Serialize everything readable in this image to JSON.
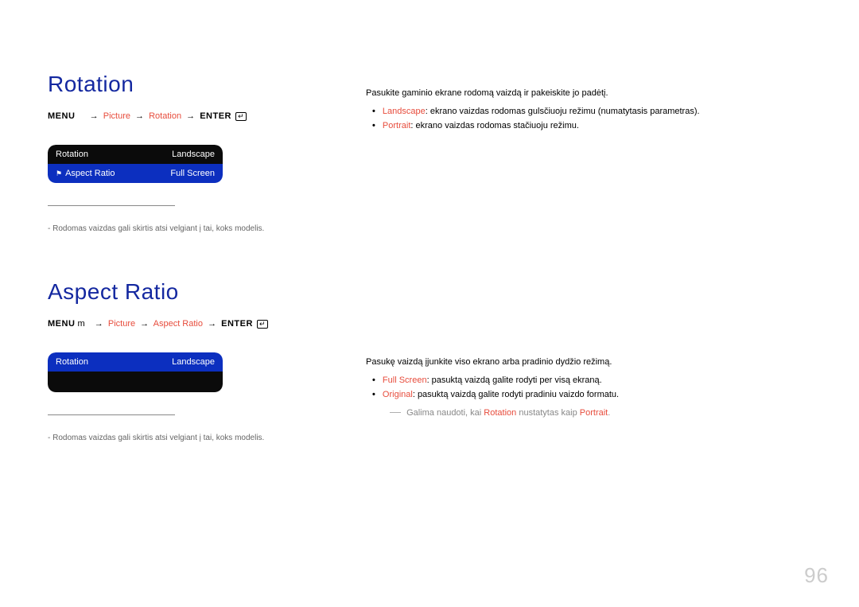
{
  "page_number": "96",
  "rotation": {
    "heading": "Rotation",
    "breadcrumb": {
      "menu": "MENU",
      "arrow": "→",
      "picture": "Picture",
      "rotation": "Rotation",
      "enter": "ENTER"
    },
    "ui": {
      "row1_label": "Rotation",
      "row1_value": "Landscape",
      "row2_label": "Aspect Ratio",
      "row2_value": "Full Screen"
    },
    "footnote": "Rodomas vaizdas gali skirtis atsi velgiant į tai, koks modelis.",
    "desc": "Pasukite gaminio ekrane rodomą vaizdą ir pakeiskite jo padėtį.",
    "bullets": {
      "landscape_term": "Landscape",
      "landscape_text": ": ekrano vaizdas rodomas gulsčiuoju režimu (numatytasis parametras).",
      "portrait_term": "Portrait",
      "portrait_text": ": ekrano vaizdas rodomas stačiuoju režimu."
    }
  },
  "aspect": {
    "heading": "Aspect Ratio",
    "breadcrumb": {
      "menu": "MENU",
      "m": "m",
      "arrow": "→",
      "picture": "Picture",
      "aspect": "Aspect Ratio",
      "enter": "ENTER"
    },
    "ui": {
      "row1_label": "Rotation",
      "row1_value": "Landscape"
    },
    "footnote": "Rodomas vaizdas gali skirtis atsi velgiant į tai, koks modelis.",
    "desc": "Pasukę vaizdą įjunkite viso ekrano arba pradinio dydžio režimą.",
    "bullets": {
      "full_term": "Full Screen",
      "full_text": ": pasuktą vaizdą galite rodyti per visą ekraną.",
      "orig_term": "Original",
      "orig_text": ": pasuktą vaizdą galite rodyti pradiniu vaizdo formatu."
    },
    "note_prefix": "Galima naudoti, kai ",
    "note_rotation": "Rotation",
    "note_mid": " nustatytas kaip ",
    "note_portrait": "Portrait",
    "note_end": "."
  }
}
